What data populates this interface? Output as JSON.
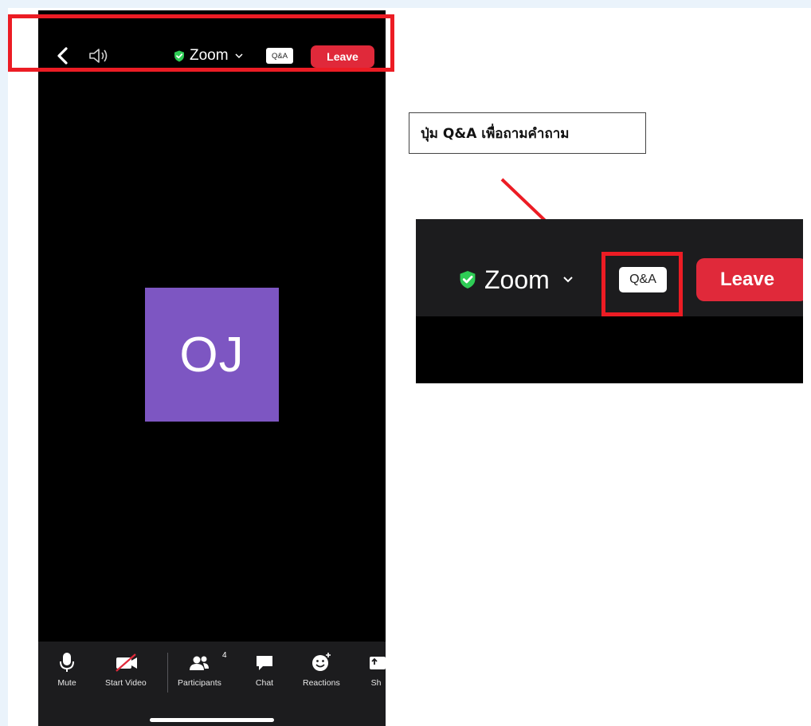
{
  "phone": {
    "meeting_name": "Zoom",
    "qa_label": "Q&A",
    "leave_label": "Leave",
    "avatar_initials": "OJ",
    "toolbar": {
      "mute": "Mute",
      "start_video": "Start Video",
      "participants": "Participants",
      "participants_count": "4",
      "chat": "Chat",
      "reactions": "Reactions",
      "share": "Sh"
    }
  },
  "callout": {
    "text": "ปุ่ม Q&A เพื่อถามคำถาม"
  },
  "zoom_inset": {
    "meeting_name": "Zoom",
    "qa_label": "Q&A",
    "leave_label": "Leave"
  },
  "colors": {
    "highlight": "#ec1c24",
    "leave": "#e0293a",
    "avatar": "#7d56c2",
    "shield": "#2ecc55"
  }
}
